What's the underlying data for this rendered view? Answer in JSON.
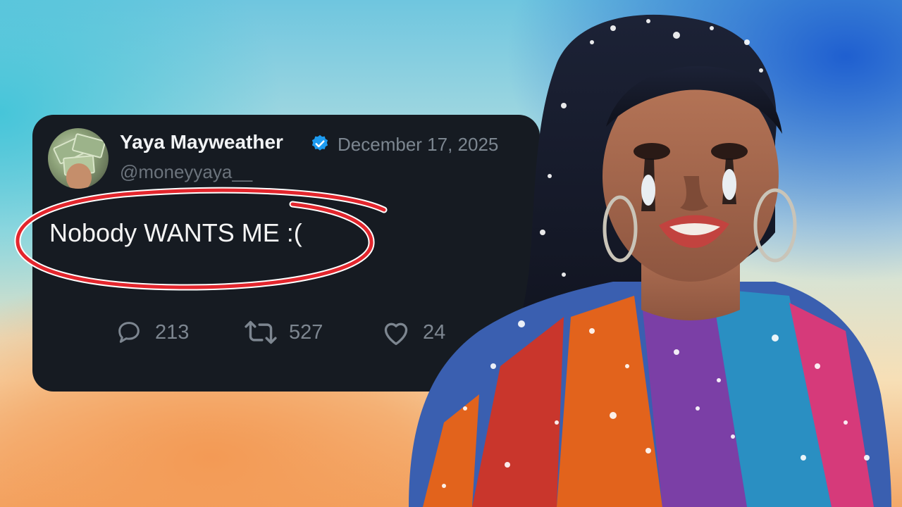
{
  "tweet": {
    "author_name": "Yaya Mayweather",
    "verified_icon": "verified-badge-icon",
    "date": "December 17, 2025",
    "handle": "@moneyyaya__",
    "text": "Nobody WANTS ME :(",
    "replies": "213",
    "retweets": "527",
    "likes": "24"
  },
  "icons": {
    "reply": "reply-icon",
    "retweet": "retweet-icon",
    "like": "heart-icon"
  },
  "colors": {
    "card_bg": "#161b22",
    "annotation_red": "#e3262d",
    "verified_blue": "#1d9bf0"
  }
}
